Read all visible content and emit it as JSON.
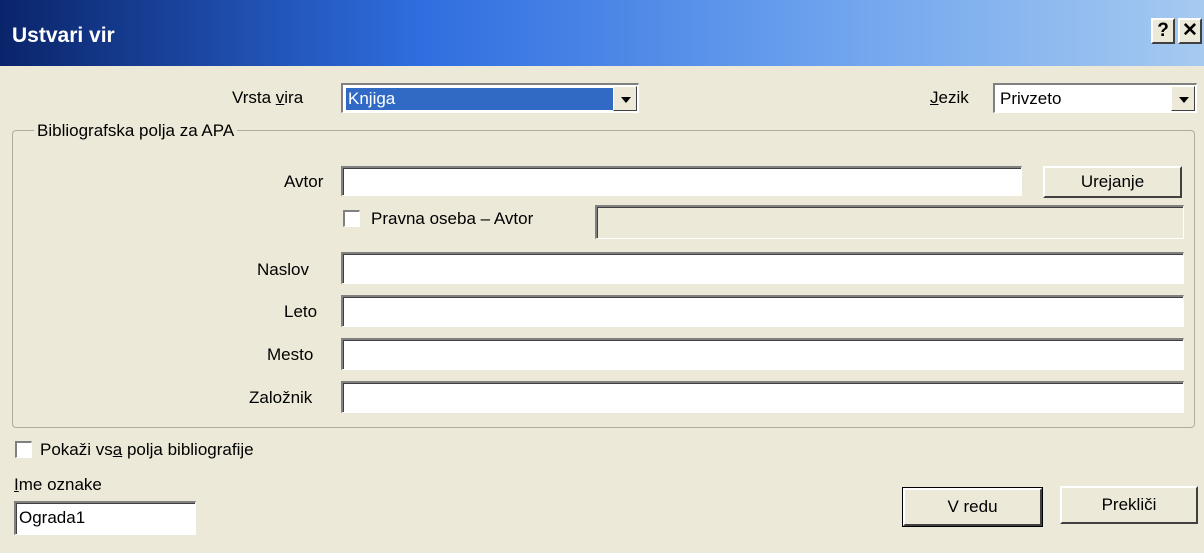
{
  "window": {
    "title": "Ustvari vir",
    "help_glyph": "?",
    "close_glyph": "✕"
  },
  "source_type": {
    "label_pre": "Vrsta ",
    "label_accel": "v",
    "label_post": "ira",
    "value": "Knjiga"
  },
  "language": {
    "label_accel": "J",
    "label_post": "ezik",
    "value": "Privzeto"
  },
  "group": {
    "title": "Bibliografska polja za APA",
    "author": {
      "label": "Avtor",
      "value": "",
      "edit_button": "Urejanje"
    },
    "corporate_author": {
      "label": "Pravna oseba – Avtor",
      "checked": false,
      "value": ""
    },
    "fields": [
      {
        "label": "Naslov",
        "value": ""
      },
      {
        "label": "Leto",
        "value": ""
      },
      {
        "label": "Mesto",
        "value": ""
      },
      {
        "label": "Založnik",
        "value": ""
      }
    ]
  },
  "show_all": {
    "label_pre": "Pokaži vs",
    "label_accel": "a",
    "label_post": " polja bibliografije",
    "checked": false
  },
  "tag_name": {
    "label_accel": "I",
    "label_post": "me oznake",
    "value": "Ograda1"
  },
  "buttons": {
    "ok": "V redu",
    "cancel": "Prekliči"
  }
}
